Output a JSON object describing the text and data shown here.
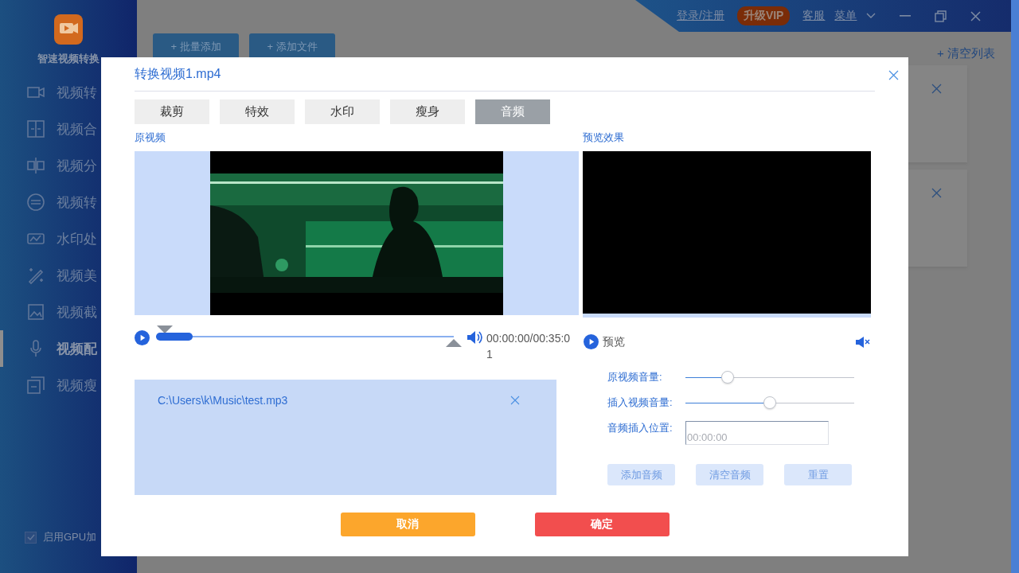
{
  "app": {
    "title": "智速视频转换"
  },
  "header": {
    "login": "登录/注册",
    "vip": "升级VIP",
    "service": "客服",
    "menu": "菜单"
  },
  "sidebar": {
    "items": [
      {
        "label": "视频转",
        "selected": false
      },
      {
        "label": "视频合",
        "selected": false
      },
      {
        "label": "视频分",
        "selected": false
      },
      {
        "label": "视频转",
        "selected": false
      },
      {
        "label": "水印处",
        "selected": false
      },
      {
        "label": "视频美",
        "selected": false
      },
      {
        "label": "视频截",
        "selected": false
      },
      {
        "label": "视频配",
        "selected": true
      },
      {
        "label": "视频瘦",
        "selected": false
      }
    ],
    "gpu": {
      "label": "启用GPU加",
      "checked": true
    }
  },
  "toolbar": {
    "buttons": [
      "+ 批量添加",
      "+ 添加文件"
    ],
    "clear": "+ 清空列表"
  },
  "dialog": {
    "title": "转换视频1.mp4",
    "tabs": [
      {
        "label": "裁剪",
        "selected": false
      },
      {
        "label": "特效",
        "selected": false
      },
      {
        "label": "水印",
        "selected": false
      },
      {
        "label": "瘦身",
        "selected": false
      },
      {
        "label": "音频",
        "selected": true
      }
    ],
    "original_label": "原视频",
    "preview_label": "预览效果",
    "progress": {
      "level": 0.12
    },
    "time": "00:00:00/00:35:01",
    "preview_button": "预览",
    "audio_files": [
      "C:\\Users\\k\\Music\\test.mp3"
    ],
    "sliders": [
      {
        "label": "原视频音量:",
        "level": 0.25
      },
      {
        "label": "插入视频音量:",
        "level": 0.5
      }
    ],
    "position": {
      "label": "音频插入位置:",
      "placeholder": "00:00:00"
    },
    "audio_buttons": [
      "添加音频",
      "清空音频",
      "重置"
    ],
    "cancel": "取消",
    "confirm": "确定"
  }
}
